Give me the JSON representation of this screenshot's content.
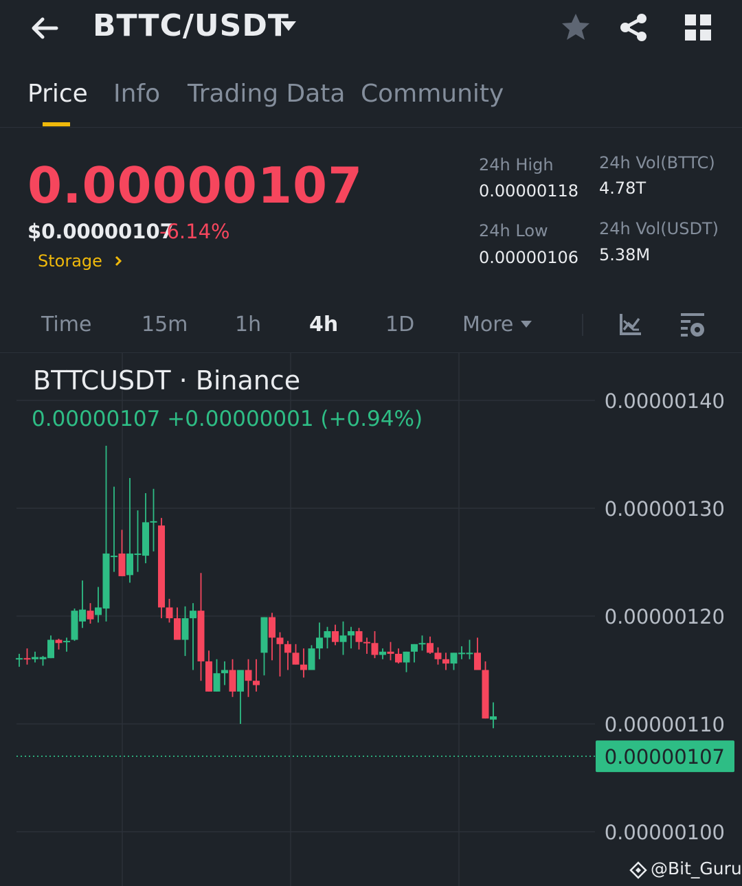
{
  "header": {
    "pair": "BTTC/USDT",
    "icons": [
      "back-arrow-icon",
      "caret-down-icon",
      "star-icon",
      "share-icon",
      "grid-icon"
    ]
  },
  "tabs": [
    {
      "label": "Price",
      "active": true
    },
    {
      "label": "Info",
      "active": false
    },
    {
      "label": "Trading Data",
      "active": false
    },
    {
      "label": "Community",
      "active": false
    }
  ],
  "price": {
    "last": "0.00000107",
    "usd": "$0.00000107",
    "change_pct": "-6.14%",
    "storage_label": "Storage"
  },
  "stats": {
    "high_label": "24h High",
    "high_value": "0.00000118",
    "low_label": "24h Low",
    "low_value": "0.00000106",
    "vol_base_label": "24h Vol(BTTC)",
    "vol_base_value": "4.78T",
    "vol_quote_label": "24h Vol(USDT)",
    "vol_quote_value": "5.38M"
  },
  "intervals": {
    "time": "Time",
    "m15": "15m",
    "h1": "1h",
    "h4": "4h",
    "d1": "1D",
    "more": "More",
    "active": "4h"
  },
  "chart": {
    "symbol_line": "BTTCUSDT · Binance",
    "ohlc_line": "0.00000107  +0.00000001 (+0.94%)",
    "y_ticks": [
      "0.00000140",
      "0.00000130",
      "0.00000120",
      "0.00000110",
      "0.00000100"
    ],
    "y_tick_values": [
      1.4,
      1.3,
      1.2,
      1.1,
      1.0
    ],
    "current_price_label": "0.00000107",
    "current_price_value": 1.07,
    "colors": {
      "up": "#2ebd85",
      "down": "#f6465d",
      "accent": "#f0b90b",
      "bg": "#1e2329"
    },
    "value_unit_note": "candle values in units of 1e-6 USDT"
  },
  "chart_data": {
    "type": "candlestick",
    "title": "BTTCUSDT · Binance",
    "y_scale_multiplier": 1e-06,
    "ylim": [
      0.95,
      1.445
    ],
    "candles": [
      {
        "o": 1.161,
        "h": 1.165,
        "l": 1.153,
        "c": 1.161
      },
      {
        "o": 1.161,
        "h": 1.17,
        "l": 1.155,
        "c": 1.16
      },
      {
        "o": 1.16,
        "h": 1.167,
        "l": 1.157,
        "c": 1.162
      },
      {
        "o": 1.16,
        "h": 1.163,
        "l": 1.154,
        "c": 1.162
      },
      {
        "o": 1.161,
        "h": 1.182,
        "l": 1.161,
        "c": 1.178
      },
      {
        "o": 1.178,
        "h": 1.179,
        "l": 1.169,
        "c": 1.175
      },
      {
        "o": 1.176,
        "h": 1.18,
        "l": 1.167,
        "c": 1.177
      },
      {
        "o": 1.178,
        "h": 1.207,
        "l": 1.177,
        "c": 1.205
      },
      {
        "o": 1.195,
        "h": 1.233,
        "l": 1.189,
        "c": 1.206
      },
      {
        "o": 1.205,
        "h": 1.212,
        "l": 1.193,
        "c": 1.197
      },
      {
        "o": 1.201,
        "h": 1.227,
        "l": 1.194,
        "c": 1.208
      },
      {
        "o": 1.207,
        "h": 1.358,
        "l": 1.195,
        "c": 1.258
      },
      {
        "o": 1.256,
        "h": 1.32,
        "l": 1.241,
        "c": 1.256
      },
      {
        "o": 1.258,
        "h": 1.28,
        "l": 1.25,
        "c": 1.237
      },
      {
        "o": 1.238,
        "h": 1.328,
        "l": 1.231,
        "c": 1.258
      },
      {
        "o": 1.258,
        "h": 1.298,
        "l": 1.241,
        "c": 1.258
      },
      {
        "o": 1.256,
        "h": 1.314,
        "l": 1.249,
        "c": 1.287
      },
      {
        "o": 1.287,
        "h": 1.318,
        "l": 1.26,
        "c": 1.288
      },
      {
        "o": 1.284,
        "h": 1.291,
        "l": 1.198,
        "c": 1.208
      },
      {
        "o": 1.208,
        "h": 1.216,
        "l": 1.194,
        "c": 1.198
      },
      {
        "o": 1.198,
        "h": 1.208,
        "l": 1.186,
        "c": 1.178
      },
      {
        "o": 1.178,
        "h": 1.209,
        "l": 1.163,
        "c": 1.198
      },
      {
        "o": 1.198,
        "h": 1.212,
        "l": 1.15,
        "c": 1.205
      },
      {
        "o": 1.205,
        "h": 1.24,
        "l": 1.14,
        "c": 1.158
      },
      {
        "o": 1.158,
        "h": 1.168,
        "l": 1.14,
        "c": 1.13
      },
      {
        "o": 1.13,
        "h": 1.16,
        "l": 1.135,
        "c": 1.147
      },
      {
        "o": 1.147,
        "h": 1.158,
        "l": 1.136,
        "c": 1.15
      },
      {
        "o": 1.15,
        "h": 1.16,
        "l": 1.125,
        "c": 1.13
      },
      {
        "o": 1.13,
        "h": 1.15,
        "l": 1.1,
        "c": 1.15
      },
      {
        "o": 1.15,
        "h": 1.16,
        "l": 1.125,
        "c": 1.14
      },
      {
        "o": 1.14,
        "h": 1.16,
        "l": 1.13,
        "c": 1.136
      },
      {
        "o": 1.166,
        "h": 1.193,
        "l": 1.145,
        "c": 1.199
      },
      {
        "o": 1.199,
        "h": 1.203,
        "l": 1.159,
        "c": 1.18
      },
      {
        "o": 1.18,
        "h": 1.185,
        "l": 1.144,
        "c": 1.174
      },
      {
        "o": 1.174,
        "h": 1.177,
        "l": 1.15,
        "c": 1.166
      },
      {
        "o": 1.166,
        "h": 1.174,
        "l": 1.155,
        "c": 1.155
      },
      {
        "o": 1.155,
        "h": 1.17,
        "l": 1.143,
        "c": 1.15
      },
      {
        "o": 1.15,
        "h": 1.173,
        "l": 1.156,
        "c": 1.17
      },
      {
        "o": 1.17,
        "h": 1.194,
        "l": 1.16,
        "c": 1.18
      },
      {
        "o": 1.18,
        "h": 1.19,
        "l": 1.17,
        "c": 1.186
      },
      {
        "o": 1.186,
        "h": 1.192,
        "l": 1.173,
        "c": 1.176
      },
      {
        "o": 1.176,
        "h": 1.195,
        "l": 1.164,
        "c": 1.182
      },
      {
        "o": 1.182,
        "h": 1.19,
        "l": 1.17,
        "c": 1.186
      },
      {
        "o": 1.186,
        "h": 1.189,
        "l": 1.169,
        "c": 1.176
      },
      {
        "o": 1.176,
        "h": 1.18,
        "l": 1.165,
        "c": 1.175
      },
      {
        "o": 1.175,
        "h": 1.186,
        "l": 1.161,
        "c": 1.164
      },
      {
        "o": 1.164,
        "h": 1.17,
        "l": 1.16,
        "c": 1.167
      },
      {
        "o": 1.167,
        "h": 1.176,
        "l": 1.159,
        "c": 1.165
      },
      {
        "o": 1.165,
        "h": 1.17,
        "l": 1.156,
        "c": 1.157
      },
      {
        "o": 1.157,
        "h": 1.164,
        "l": 1.148,
        "c": 1.167
      },
      {
        "o": 1.167,
        "h": 1.171,
        "l": 1.157,
        "c": 1.174
      },
      {
        "o": 1.174,
        "h": 1.182,
        "l": 1.168,
        "c": 1.175
      },
      {
        "o": 1.175,
        "h": 1.181,
        "l": 1.165,
        "c": 1.166
      },
      {
        "o": 1.166,
        "h": 1.171,
        "l": 1.155,
        "c": 1.16
      },
      {
        "o": 1.16,
        "h": 1.166,
        "l": 1.15,
        "c": 1.156
      },
      {
        "o": 1.156,
        "h": 1.165,
        "l": 1.15,
        "c": 1.166
      },
      {
        "o": 1.166,
        "h": 1.172,
        "l": 1.16,
        "c": 1.166
      },
      {
        "o": 1.166,
        "h": 1.178,
        "l": 1.16,
        "c": 1.166
      },
      {
        "o": 1.166,
        "h": 1.18,
        "l": 1.15,
        "c": 1.15
      },
      {
        "o": 1.15,
        "h": 1.158,
        "l": 1.105,
        "c": 1.105
      },
      {
        "o": 1.104,
        "h": 1.12,
        "l": 1.096,
        "c": 1.107
      }
    ]
  }
}
